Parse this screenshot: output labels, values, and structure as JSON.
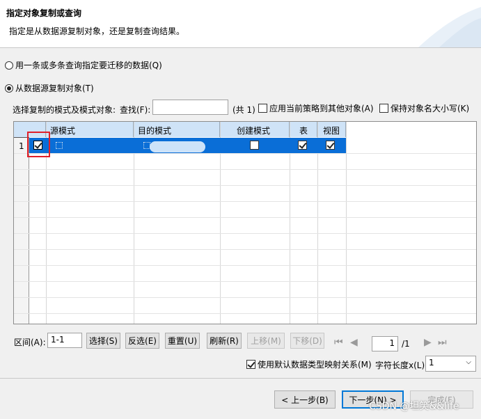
{
  "header": {
    "title": "指定对象复制或查询",
    "subtitle": "指定是从数据源复制对象，还是复制查询结果。"
  },
  "options": {
    "query_option": "用一条或多条查询指定要迁移的数据(Q)",
    "copy_option": "从数据源复制对象(T)"
  },
  "filter": {
    "label": "选择复制的模式及模式对象:",
    "find_label": "查找(F):",
    "find_value": "",
    "count": "(共 1)",
    "apply_policy": "应用当前策略到其他对象(A)",
    "keep_case": "保持对象名大小写(K)"
  },
  "table": {
    "columns": [
      "源模式",
      "目的模式",
      "创建模式",
      "表",
      "视图"
    ],
    "rows": [
      {
        "num": "1",
        "selected": true,
        "create_schema": false,
        "table": true,
        "view": true
      }
    ]
  },
  "range": {
    "label": "区间(A):",
    "value": "1-1",
    "select": "选择(S)",
    "invert": "反选(E)",
    "reset": "重置(U)",
    "refresh": "刷新(R)",
    "move_up": "上移(M)",
    "move_down": "下移(D)",
    "page": "1",
    "total": "/1"
  },
  "mapping": {
    "label": "使用默认数据类型映射关系(M)",
    "charlen_label": "字符长度x(L):",
    "charlen_value": "1"
  },
  "buttons": {
    "prev": "< 上一步(B)",
    "next": "下一步(N) >",
    "finish": "完成(F)"
  },
  "watermark": "CSDN @坦笑&&life",
  "colors": {
    "selection": "#0a6ed7",
    "header": "#cfe3f7",
    "highlight": "#e0202a"
  }
}
